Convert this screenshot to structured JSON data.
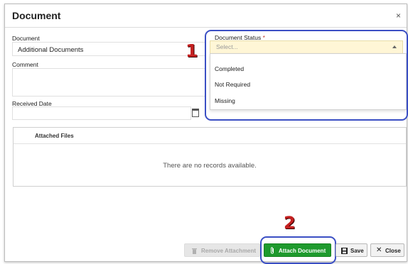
{
  "dialog": {
    "title": "Document",
    "close_glyph": "×"
  },
  "form": {
    "document_label": "Document",
    "document_value": "Additional Documents",
    "comment_label": "Comment",
    "comment_value": "",
    "received_date_label": "Received Date",
    "received_date_value": "",
    "status_label": "Document Status",
    "status_required_mark": "*",
    "status_placeholder": "Select...",
    "status_options": [
      "Completed",
      "Not Required",
      "Missing"
    ]
  },
  "attached_files": {
    "header": "Attached Files",
    "empty_message": "There are no records available."
  },
  "buttons": {
    "remove_label": "Remove Attachment",
    "attach_label": "Attach Document",
    "save_label": "Save",
    "close_label": "Close"
  },
  "annotations": {
    "marker_1": "1",
    "marker_2": "2",
    "highlight_color": "#3b4fc4",
    "marker_color": "#c42020"
  },
  "colors": {
    "primary_button": "#1e9a2d",
    "select_bg": "#fff6d6"
  },
  "icons": {
    "calendar": "calendar-icon",
    "trash": "trash-icon",
    "paperclip": "paperclip-icon",
    "save": "save-icon",
    "close": "close-icon"
  }
}
